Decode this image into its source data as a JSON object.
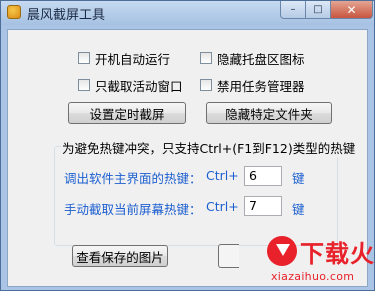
{
  "window": {
    "title": "晨风截屏工具",
    "icon": "app-icon",
    "controls": {
      "minimize": "–",
      "maximize": "□",
      "close": "✕"
    }
  },
  "options": {
    "autostart": {
      "label": "开机自动运行",
      "checked": false
    },
    "hide_tray": {
      "label": "隐藏托盘区图标",
      "checked": false
    },
    "active_window_only": {
      "label": "只截取活动窗口",
      "checked": false
    },
    "disable_taskmgr": {
      "label": "禁用任务管理器",
      "checked": false
    }
  },
  "buttons": {
    "schedule": "设置定时截屏",
    "hide_folder": "隐藏特定文件夹",
    "view_saved": "查看保存的图片"
  },
  "hotkeys": {
    "caption": "为避免热键冲突，只支持Ctrl+(F1到F12)类型的热键",
    "main_ui": {
      "label": "调出软件主界面的热键：",
      "prefix": "Ctrl+ F",
      "value": "6",
      "suffix": "键"
    },
    "capture": {
      "label": "手动截取当前屏幕热键：",
      "prefix": "Ctrl+ F",
      "value": "7",
      "suffix": "键"
    }
  },
  "watermark": {
    "name": "下载火",
    "url": "xiazaihuo.com",
    "color": "#e8212a"
  }
}
